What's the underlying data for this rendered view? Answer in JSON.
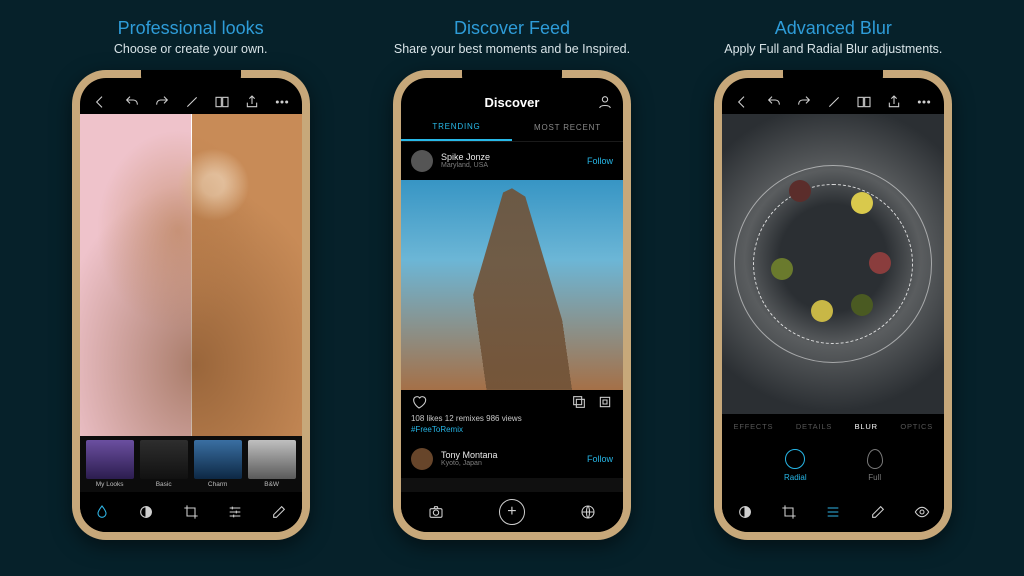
{
  "panels": [
    {
      "title": "Professional looks",
      "subtitle": "Choose or create your own.",
      "looks": [
        "My Looks",
        "Basic",
        "Charm",
        "B&W"
      ],
      "toolbar_icons": [
        "back",
        "undo",
        "redo",
        "magic",
        "compare",
        "share",
        "more"
      ],
      "bottom_icons": [
        "filter-drop",
        "contrast",
        "crop",
        "sliders",
        "eraser"
      ]
    },
    {
      "title": "Discover Feed",
      "subtitle": "Share your best moments and be Inspired.",
      "header": "Discover",
      "tabs": [
        "TRENDING",
        "MOST RECENT"
      ],
      "active_tab": 0,
      "post": {
        "author": "Spike Jonze",
        "location": "Maryland, USA",
        "follow": "Follow",
        "stats": "108 likes   12 remixes   986 views",
        "hashtag": "#FreeToRemix"
      },
      "post2": {
        "author": "Tony Montana",
        "location": "Kyoto, Japan",
        "follow": "Follow"
      },
      "bottom_icons": [
        "camera",
        "add",
        "globe"
      ]
    },
    {
      "title": "Advanced Blur",
      "subtitle": "Apply Full and Radial Blur adjustments.",
      "tabs": [
        "EFFECTS",
        "DETAILS",
        "BLUR",
        "OPTICS"
      ],
      "active_tab": 2,
      "blur_options": [
        {
          "label": "Radial",
          "active": true
        },
        {
          "label": "Full",
          "active": false
        }
      ],
      "bottom_icons": [
        "contrast",
        "crop",
        "sliders",
        "eraser",
        "eye"
      ]
    }
  ]
}
